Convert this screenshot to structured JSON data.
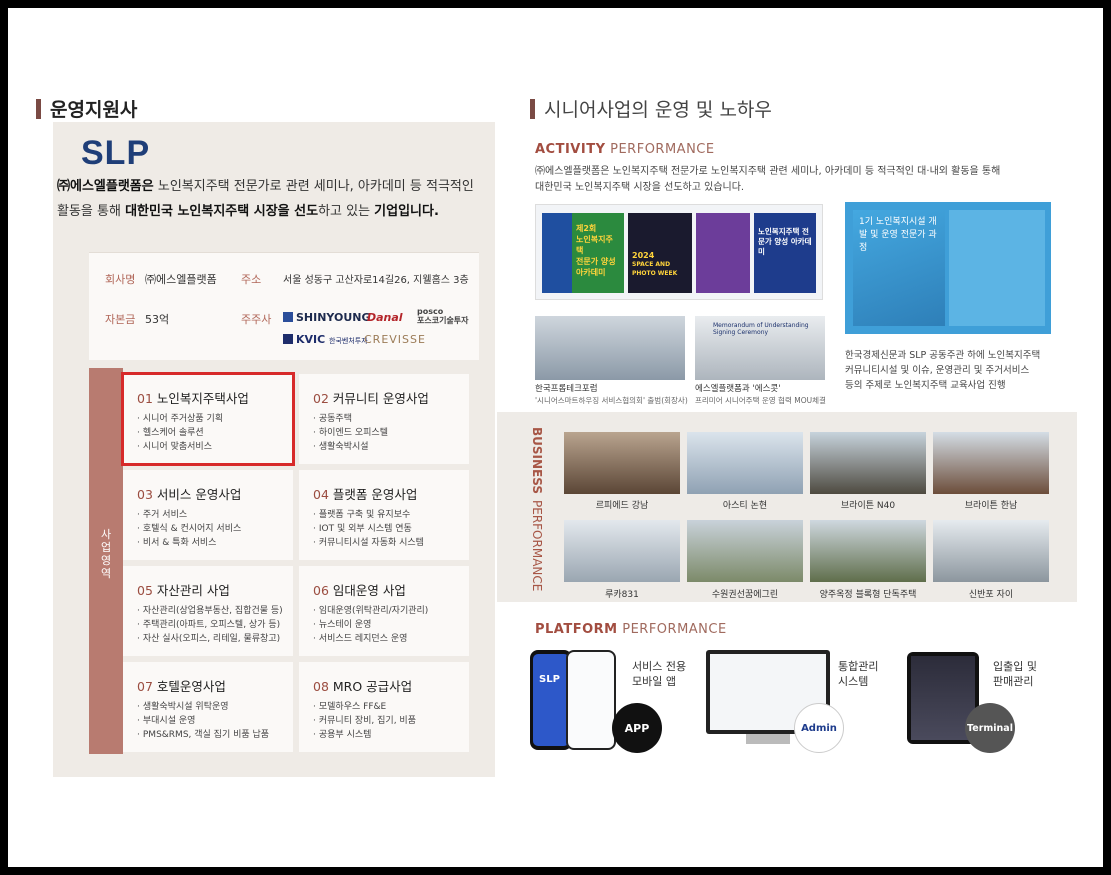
{
  "left": {
    "section_title": "운영지원사",
    "logo": "SLP",
    "intro": {
      "company": "㈜에스엘플랫폼은",
      "text1": " 노인복지주택 전문가로 관련 세미나, 아카데미 등 적극적인 활동을 통해 ",
      "highlight": "대한민국 노인복지주택 시장을 선도",
      "text2": "하고 있는 ",
      "end": "기업입니다."
    },
    "info": {
      "company_label": "회사명",
      "company_value": "㈜에스엘플랫폼",
      "address_label": "주소",
      "address_value": "서울 성동구 고산자로14길26, 지웰홈스 3층",
      "capital_label": "자본금",
      "capital_value": "53억",
      "shareholders_label": "주주사",
      "shareholders": [
        "SHINYOUNG",
        "Danal",
        "posco",
        "포스코기술투자",
        "KVIC",
        "한국벤처투자",
        "CREVISSE"
      ]
    },
    "side_tab": "사업영역",
    "businesses": [
      {
        "num": "01",
        "title": "노인복지주택사업",
        "items": [
          "시니어 주거상품 기획",
          "헬스케어 솔루션",
          "시니어 맞춤서비스"
        ]
      },
      {
        "num": "02",
        "title": "커뮤니티 운영사업",
        "items": [
          "공동주택",
          "하이엔드 오피스텔",
          "생활숙박시설"
        ]
      },
      {
        "num": "03",
        "title": "서비스 운영사업",
        "items": [
          "주거 서비스",
          "호텔식 & 컨시어지 서비스",
          "비서 & 특화 서비스"
        ]
      },
      {
        "num": "04",
        "title": "플랫폼 운영사업",
        "items": [
          "플랫폼 구축 및 유지보수",
          "IOT 및 외부 시스템 연동",
          "커뮤니티시설 자동화 시스템"
        ]
      },
      {
        "num": "05",
        "title": "자산관리 사업",
        "items": [
          "자산관리(상업용부동산, 집합건물 등)",
          "주택관리(아파트, 오피스텔, 상가 등)",
          "자산 실사(오피스, 리테일, 물류창고)"
        ]
      },
      {
        "num": "06",
        "title": "임대운영 사업",
        "items": [
          "임대운영(위탁관리/자기관리)",
          "뉴스테이 운영",
          "서비스드 레지던스 운영"
        ]
      },
      {
        "num": "07",
        "title": "호텔운영사업",
        "items": [
          "생활숙박시설 위탁운영",
          "부대시설 운영",
          "PMS&RMS, 객실 집기 비품 납품"
        ]
      },
      {
        "num": "08",
        "title": "MRO 공급사업",
        "items": [
          "모델하우스 FF&E",
          "커뮤니티 장비, 집기, 비품",
          "공용부 시스템"
        ]
      }
    ]
  },
  "right": {
    "section_title": "시니어사업의 운영 및 노하우",
    "activity": {
      "title_bold": "ACTIVITY",
      "title_light": " PERFORMANCE",
      "desc1": "㈜에스엘플랫폼은 노인복지주택 전문가로 노인복지주택 관련 세미나, 아카데미 등 적극적인 대·내외 활동을 통해",
      "desc2": "대한민국 노인복지주택 시장을 선도하고 있습니다.",
      "poster_texts": [
        "제2회",
        "노인복지주택",
        "전문가 양성",
        "아카데미",
        "2024",
        "SPACE AND PHOTO WEEK",
        "노인복지주택 전문가 양성 아카데미"
      ],
      "photo_caption_1": "한국프롭테크포럼",
      "photo_sub_1": "'시니어스마트하우징 서비스협의회' 출범(회장사)",
      "photo_caption_2": "에스엘플랫폼과 '에스콧'",
      "photo_sub_2": "프리미어 시니어주택 운영 협력 MOU체결",
      "mou_banner": "Memorandum of Understanding Signing Ceremony",
      "academy_title": "1기 노인복지시설 개발 및 운영 전문가 과정",
      "academy_desc1": "한국경제신문과 SLP 공동주관 하에 노인복지주택",
      "academy_desc2": "커뮤니티시설 및 이슈, 운영관리 및 주거서비스",
      "academy_desc3": "등의 주제로 노인복지주택 교육사업 진행"
    },
    "business": {
      "title_bold": "BUSINESS",
      "title_light": "PERFORMANCE",
      "projects": [
        "르피에드 강남",
        "아스티 논현",
        "브라이튼 N40",
        "브라이튼 한남",
        "루카831",
        "수원권선꿈에그린",
        "양주옥정 블록형 단독주택",
        "신반포 자이"
      ]
    },
    "platform": {
      "title_bold": "PLATFORM",
      "title_light": " PERFORMANCE",
      "items": [
        {
          "label1": "서비스 전용",
          "label2": "모바일 앱",
          "badge": "APP"
        },
        {
          "label1": "통합관리",
          "label2": "시스템",
          "badge": "Admin"
        },
        {
          "label1": "입출입 및",
          "label2": "판매관리",
          "badge": "Terminal"
        }
      ],
      "phone_logo": "SLP"
    }
  },
  "colors": {
    "accent": "#a24d40",
    "highlight_box": "#d72a2a",
    "side_tab": "#b87b70",
    "panel_bg": "#efebe6"
  }
}
